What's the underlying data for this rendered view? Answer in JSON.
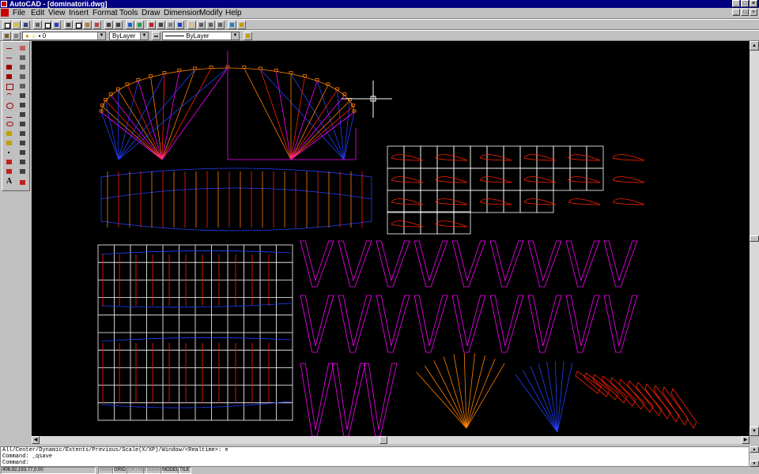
{
  "window": {
    "title": "AutoCAD - [dominatorii.dwg]"
  },
  "menu": [
    "File",
    "Edit",
    "View",
    "Insert",
    "Format",
    "Tools",
    "Draw",
    "Dimension",
    "Modify",
    "Help"
  ],
  "layer_toolbar": {
    "layer_value": "0",
    "color_value": "ByLayer",
    "linetype_value": "ByLayer"
  },
  "command_lines": [
    "All/Center/Dynamic/Extents/Previous/Scale(X/XP)/Window/<Realtime>: e",
    "Command: _qsave",
    "Command:"
  ],
  "status": {
    "coords": "406.92,193.77,0.00",
    "toggles": [
      {
        "label": "SNAP",
        "on": false
      },
      {
        "label": "GRID",
        "on": true
      },
      {
        "label": "ORTHO",
        "on": false
      },
      {
        "label": "OSNAP",
        "on": false
      },
      {
        "label": "MODEL",
        "on": true
      },
      {
        "label": "TILE",
        "on": true
      }
    ]
  },
  "colors": {
    "magenta": "#ff00ff",
    "red": "#ff2000",
    "orange": "#ff8000",
    "blue": "#2040ff",
    "white": "#ffffff",
    "crosshair": "#ffffff"
  }
}
